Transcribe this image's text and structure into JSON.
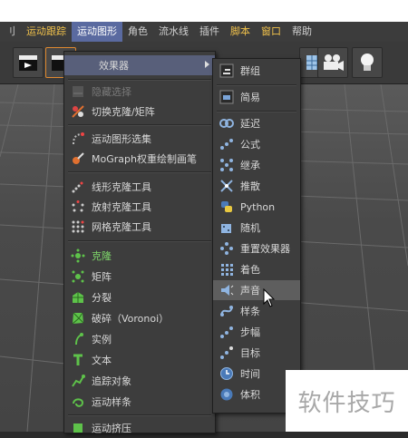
{
  "menubar": [
    {
      "label": "刂",
      "style": "normal"
    },
    {
      "label": "运动跟踪",
      "style": "hl"
    },
    {
      "label": "运动图形",
      "style": "active"
    },
    {
      "label": "角色",
      "style": "normal"
    },
    {
      "label": "流水线",
      "style": "normal"
    },
    {
      "label": "插件",
      "style": "normal"
    },
    {
      "label": "脚本",
      "style": "hl"
    },
    {
      "label": "窗口",
      "style": "hl"
    },
    {
      "label": "帮助",
      "style": "normal"
    }
  ],
  "menu1": {
    "effector": "效果器",
    "hide_selection": "隐藏选择",
    "toggle_clone_matrix": "切换克隆/矩阵",
    "mograph_selection": "运动图形选集",
    "mograph_weight_paint": "MoGraph权重绘制画笔",
    "linear_clone_tool": "线形克隆工具",
    "radial_clone_tool": "放射克隆工具",
    "grid_clone_tool": "网格克隆工具",
    "cloner": "克隆",
    "matrix": "矩阵",
    "fracture": "分裂",
    "voronoi": "破碎（Voronoi）",
    "instance": "实例",
    "text": "文本",
    "tracer": "追踪对象",
    "mospline": "运动样条",
    "moextrude": "运动挤压"
  },
  "menu2": {
    "group": "群组",
    "plain": "简易",
    "delay": "延迟",
    "formula": "公式",
    "inheritance": "继承",
    "push_apart": "推散",
    "python": "Python",
    "random": "随机",
    "reeffector": "重置效果器",
    "shader": "着色",
    "sound": "声音",
    "spline": "样条",
    "step": "步幅",
    "target": "目标",
    "time": "时间",
    "volume": "体积"
  },
  "watermark": "软件技巧"
}
